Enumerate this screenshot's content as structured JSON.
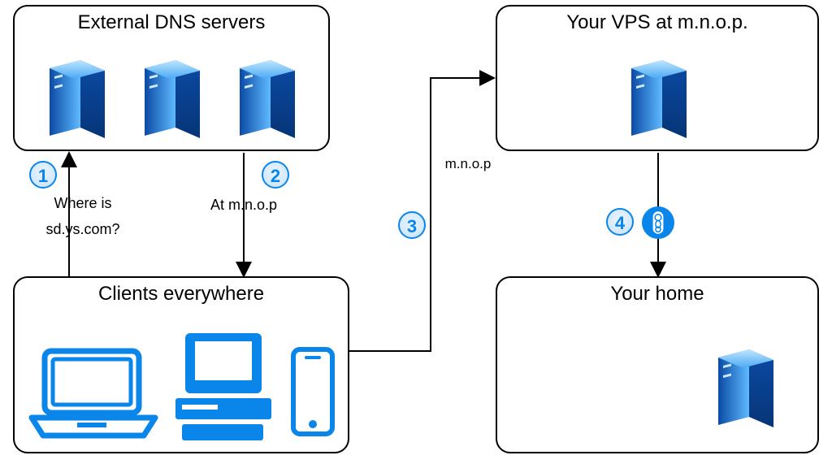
{
  "boxes": {
    "dns": {
      "title": "External DNS servers"
    },
    "vps": {
      "title": "Your VPS at m.n.o.p."
    },
    "clients": {
      "title": "Clients everywhere"
    },
    "home": {
      "title": "Your home"
    }
  },
  "steps": {
    "s1": "1",
    "s2": "2",
    "s3": "3",
    "s4": "4"
  },
  "labels": {
    "query_line1": "Where is",
    "query_line2": "sd.ys.com?",
    "answer": "At m.n.o.p",
    "route3": "m.n.o.p"
  },
  "colors": {
    "blue_main": "#0a85e9",
    "blue_dark": "#0b4aa5",
    "blue_light": "#aee2ff"
  },
  "icons": {
    "server": "server-icon",
    "laptop": "laptop-icon",
    "desktop": "desktop-icon",
    "phone": "phone-icon",
    "wireguard": "wireguard-icon"
  }
}
